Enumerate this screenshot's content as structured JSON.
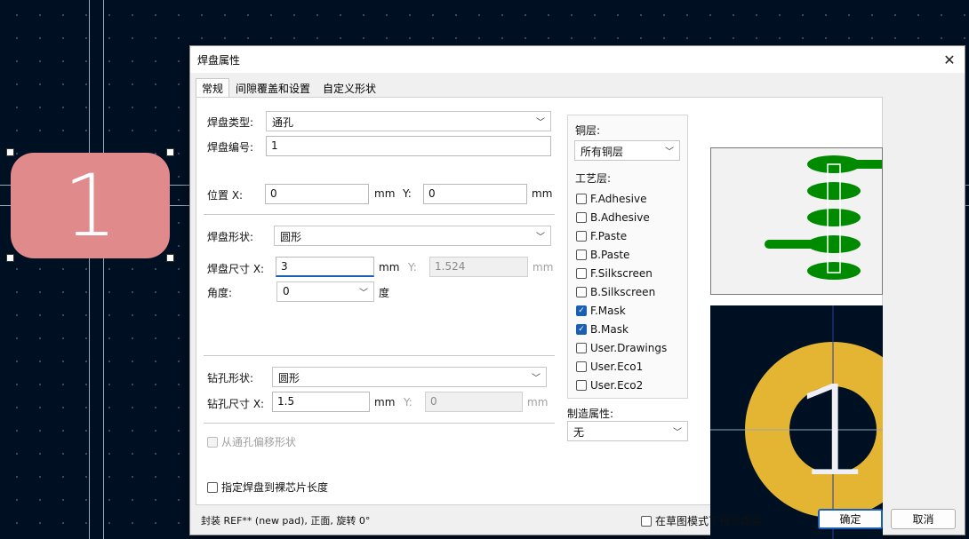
{
  "canvas": {
    "pad_number": "1"
  },
  "dialog": {
    "title": "焊盘属性",
    "close": "✕",
    "tabs": [
      {
        "label": "常规"
      },
      {
        "label": "间隙覆盖和设置"
      },
      {
        "label": "自定义形状"
      }
    ],
    "general": {
      "pad_type_label": "焊盘类型:",
      "pad_type_value": "通孔",
      "pad_number_label": "焊盘编号:",
      "pad_number_value": "1",
      "position_x_label": "位置 X:",
      "position_x_value": "0",
      "position_x_unit": "mm",
      "position_y_label": "Y:",
      "position_y_value": "0",
      "position_y_unit": "mm",
      "pad_shape_label": "焊盘形状:",
      "pad_shape_value": "圆形",
      "pad_size_x_label": "焊盘尺寸 X:",
      "pad_size_x_value": "3",
      "pad_size_x_unit": "mm",
      "pad_size_y_label": "Y:",
      "pad_size_y_value": "1.524",
      "pad_size_y_unit": "mm",
      "angle_label": "角度:",
      "angle_value": "0",
      "angle_unit": "度",
      "drill_shape_label": "钻孔形状:",
      "drill_shape_value": "圆形",
      "drill_size_x_label": "钻孔尺寸 X:",
      "drill_size_x_value": "1.5",
      "drill_size_x_unit": "mm",
      "drill_size_y_label": "Y:",
      "drill_size_y_value": "0",
      "drill_size_y_unit": "mm",
      "offset_label": "从通孔偏移形状",
      "die_length_label": "指定焊盘到裸芯片长度"
    },
    "layers": {
      "copper_label": "铜层:",
      "copper_value": "所有铜层",
      "tech_label": "工艺层:",
      "items": [
        {
          "label": "F.Adhesive",
          "checked": false
        },
        {
          "label": "B.Adhesive",
          "checked": false
        },
        {
          "label": "F.Paste",
          "checked": false
        },
        {
          "label": "B.Paste",
          "checked": false
        },
        {
          "label": "F.Silkscreen",
          "checked": false
        },
        {
          "label": "B.Silkscreen",
          "checked": false
        },
        {
          "label": "F.Mask",
          "checked": true
        },
        {
          "label": "B.Mask",
          "checked": true
        },
        {
          "label": "User.Drawings",
          "checked": false
        },
        {
          "label": "User.Eco1",
          "checked": false
        },
        {
          "label": "User.Eco2",
          "checked": false
        }
      ],
      "fab_label": "制造属性:",
      "fab_value": "无"
    },
    "preview": {
      "pad_number": "1"
    },
    "footer": {
      "status": "封装 REF** (new pad), 正面, 旋转 0°",
      "sketch_label": "在草图模式下预览焊盘",
      "ok": "确定",
      "cancel": "取消"
    },
    "colors": {
      "pad_fill": "#e08a8c",
      "preview_pad": "#e3b533",
      "stack_green": "#008a00",
      "accent": "#1a5fb4"
    }
  }
}
